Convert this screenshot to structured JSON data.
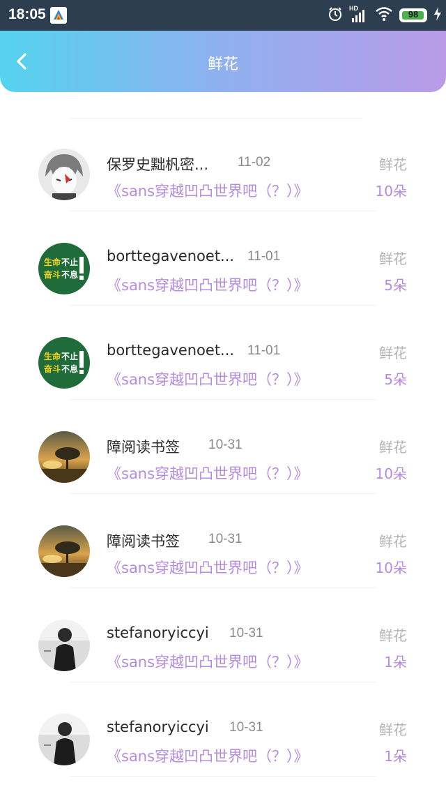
{
  "status_bar": {
    "time": "18:05",
    "network": "HD",
    "battery": "98",
    "icons": [
      "app-icon",
      "alarm-icon",
      "signal-icon",
      "wifi-icon",
      "battery-icon",
      "charging-icon"
    ]
  },
  "header": {
    "title": "鲜花",
    "back_icon": "chevron-left-icon",
    "gradient": [
      "#55d3ee",
      "#b99be8"
    ]
  },
  "colors": {
    "accent": "#b68be0",
    "muted": "#b3b3b3"
  },
  "records": [
    {
      "avatar": "anime-avatar",
      "name": "保罗史黜杋密...",
      "date": "11-02",
      "book": "《sans穿越凹凸世界吧（？）》",
      "type": "鲜花",
      "count": "10朵"
    },
    {
      "avatar": "motto-avatar",
      "avatar_text": [
        "生命",
        "不止",
        "奋斗",
        "不息"
      ],
      "name": "borttegavenoet...",
      "date": "11-01",
      "book": "《sans穿越凹凸世界吧（？）》",
      "type": "鲜花",
      "count": "5朵"
    },
    {
      "avatar": "motto-avatar",
      "avatar_text": [
        "生命",
        "不止",
        "奋斗",
        "不息"
      ],
      "name": "borttegavenoet...",
      "date": "11-01",
      "book": "《sans穿越凹凸世界吧（？）》",
      "type": "鲜花",
      "count": "5朵"
    },
    {
      "avatar": "sunset-tree-avatar",
      "name": "障阅读书签",
      "date": "10-31",
      "book": "《sans穿越凹凸世界吧（？）》",
      "type": "鲜花",
      "count": "10朵"
    },
    {
      "avatar": "sunset-tree-avatar",
      "name": "障阅读书签",
      "date": "10-31",
      "book": "《sans穿越凹凸世界吧（？）》",
      "type": "鲜花",
      "count": "10朵"
    },
    {
      "avatar": "bw-person-avatar",
      "name": "stefanoryiccyi",
      "date": "10-31",
      "book": "《sans穿越凹凸世界吧（？）》",
      "type": "鲜花",
      "count": "1朵"
    },
    {
      "avatar": "bw-person-avatar",
      "name": "stefanoryiccyi",
      "date": "10-31",
      "book": "《sans穿越凹凸世界吧（？）》",
      "type": "鲜花",
      "count": "1朵"
    }
  ]
}
